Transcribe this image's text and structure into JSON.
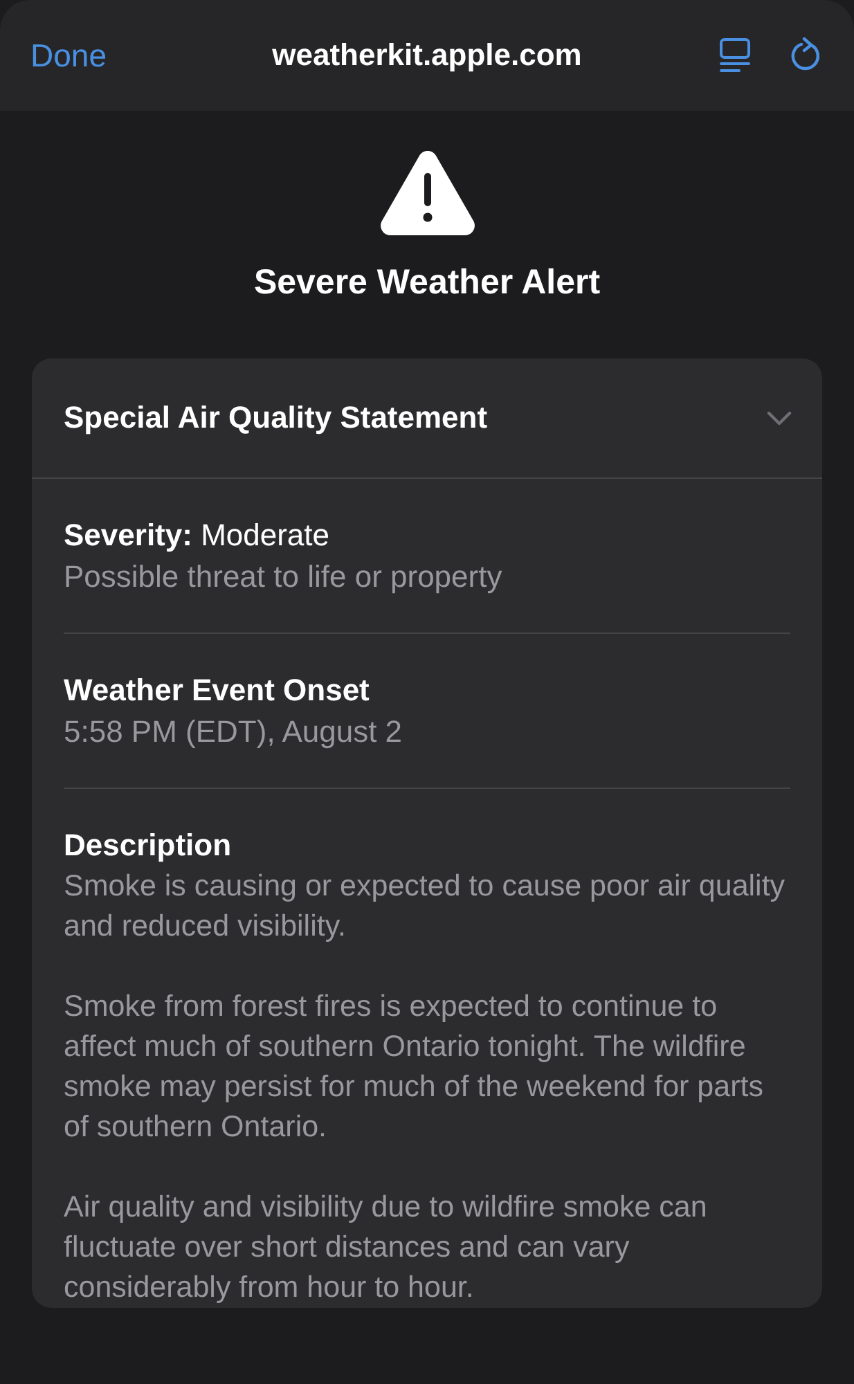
{
  "nav_bar": {
    "done_button": "Done",
    "title": "weatherkit.apple.com"
  },
  "alert": {
    "heading": "Severe Weather Alert"
  },
  "card": {
    "title": "Special Air Quality Statement",
    "expanded": true,
    "sections": [
      {
        "kind": "severity",
        "heading": "**Severity:** Moderate",
        "detail": "Possible threat to life or property"
      },
      {
        "kind": "onset",
        "heading": "Weather Event Onset",
        "detail": "5:58 PM (EDT), August 2"
      },
      {
        "kind": "description",
        "heading": "Description",
        "paragraphs": [
          "Smoke is causing or expected to cause poor air quality and reduced visibility.",
          "Smoke from forest fires is expected to continue to affect much of southern Ontario tonight. The wildfire smoke may persist for much of the weekend for parts of southern Ontario.",
          "Air quality and visibility due to wildfire smoke can fluctuate over short distances and can vary considerably from hour to hour."
        ]
      }
    ]
  }
}
